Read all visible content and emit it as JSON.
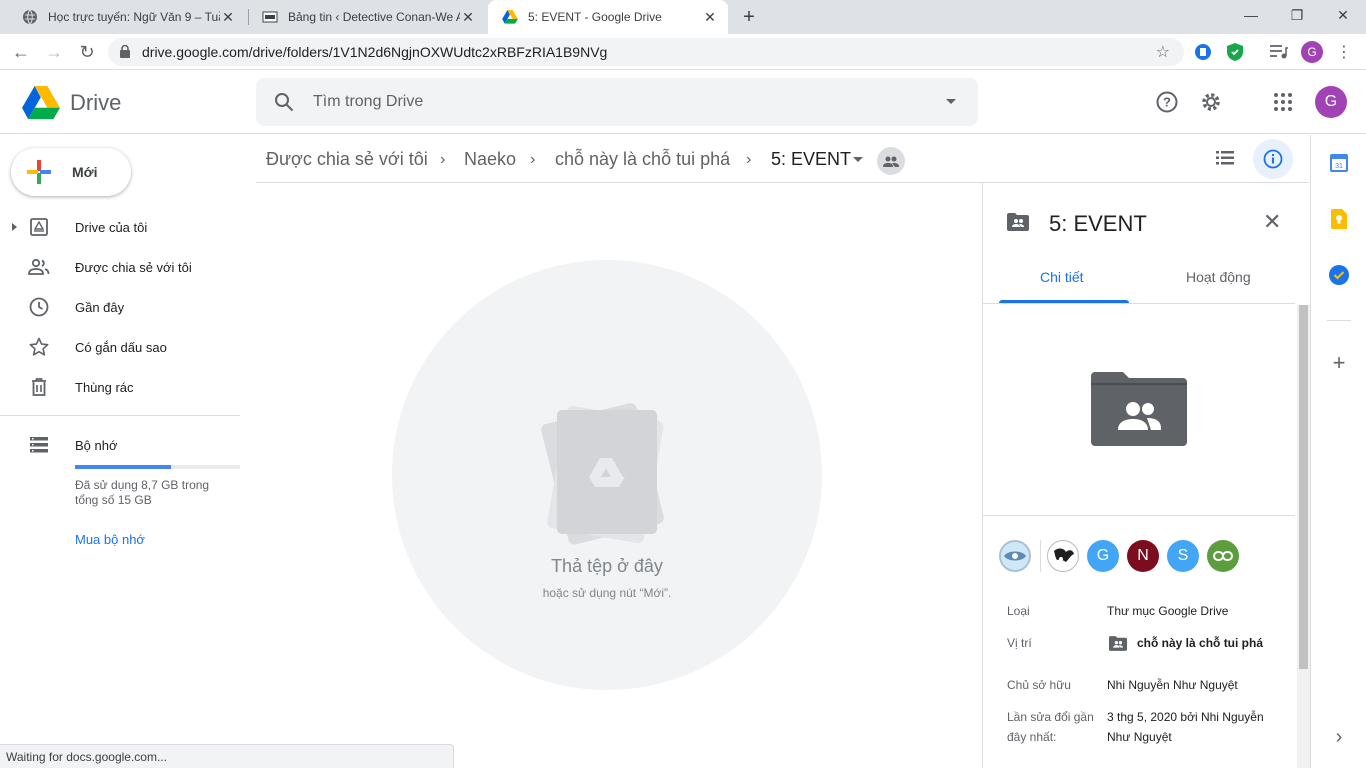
{
  "browser": {
    "tabs": [
      {
        "title": "Học trực tuyến: Ngữ Văn 9 – Tuầ"
      },
      {
        "title": "Bảng tin ‹ Detective Conan-We A"
      },
      {
        "title": "5: EVENT - Google Drive"
      }
    ],
    "url": "drive.google.com/drive/folders/1V1N2d6NgjnOXWUdtc2xRBFzRIA1B9NVg",
    "status": "Waiting for docs.google.com..."
  },
  "app": {
    "name": "Drive",
    "search_placeholder": "Tìm trong Drive",
    "avatar_letter": "G"
  },
  "sidebar": {
    "new_label": "Mới",
    "items": [
      {
        "label": "Drive của tôi",
        "icon": "my-drive-icon"
      },
      {
        "label": "Được chia sẻ với tôi",
        "icon": "people-icon"
      },
      {
        "label": "Gần đây",
        "icon": "clock-icon"
      },
      {
        "label": "Có gắn dấu sao",
        "icon": "star-icon"
      },
      {
        "label": "Thùng rác",
        "icon": "trash-icon"
      }
    ],
    "storage": {
      "label": "Bộ nhớ",
      "used_text": "Đã sử dụng 8,7 GB trong tổng số 15 GB",
      "used_fraction": 0.58,
      "buy_label": "Mua bộ nhớ"
    }
  },
  "breadcrumb": [
    "Được chia sẻ với tôi",
    "Naeko",
    "chỗ này là chỗ tui phá",
    "5: EVENT"
  ],
  "empty_state": {
    "title": "Thả tệp ở đây",
    "subtitle": "hoặc sử dụng nút “Mới”."
  },
  "details": {
    "title": "5: EVENT",
    "tabs": [
      "Chi tiết",
      "Hoạt động"
    ],
    "sharers": [
      {
        "letter": "G",
        "color": "#42a5f5"
      },
      {
        "letter": "N",
        "color": "#7b0d1e"
      },
      {
        "letter": "S",
        "color": "#42a5f5"
      }
    ],
    "fields": [
      {
        "label": "Loại",
        "value": "Thư mục Google Drive"
      },
      {
        "label": "Vị trí",
        "value": "chỗ này là chỗ tui phá"
      },
      {
        "label": "Chủ sở hữu",
        "value": "Nhi Nguyễn Như Nguyệt"
      },
      {
        "label": "Lần sửa đổi gần đây nhất:",
        "value": "3 thg 5, 2020 bởi Nhi Nguyễn Như Nguyệt"
      }
    ]
  },
  "colors": {
    "accent": "#1a73e8",
    "avatar": "#a142b5"
  }
}
